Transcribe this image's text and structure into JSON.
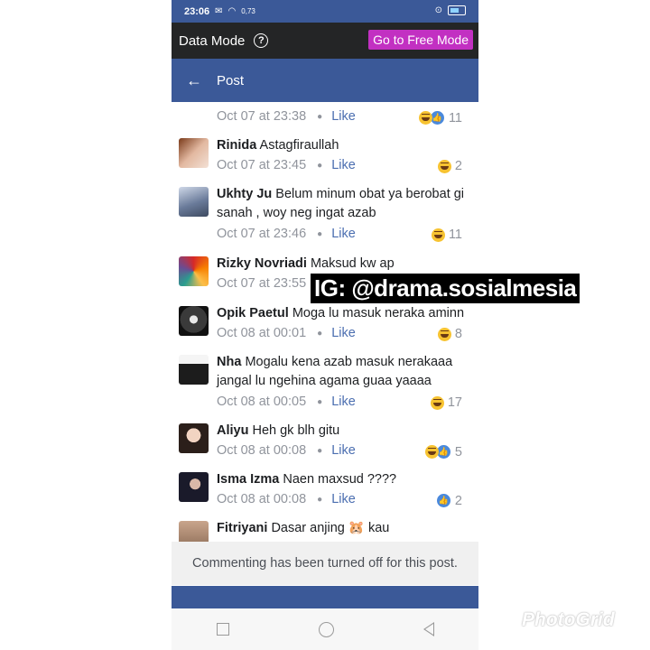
{
  "status_bar": {
    "time": "23:06",
    "net_speed": "0,73",
    "net_unit": "KB/S"
  },
  "data_mode": {
    "label": "Data Mode",
    "help_icon": "help-circle-icon",
    "free_mode_button": "Go to Free Mode"
  },
  "post_header": {
    "back_icon": "arrow-left-icon",
    "title": "Post"
  },
  "comments": [
    {
      "name": "",
      "text": "",
      "time": "Oct 07 at 23:38",
      "like_label": "Like",
      "reactions": [
        "haha",
        "like"
      ],
      "count": "11"
    },
    {
      "name": "Rinida",
      "text": "Astagfiraullah",
      "time": "Oct 07 at 23:45",
      "like_label": "Like",
      "reactions": [
        "haha"
      ],
      "count": "2"
    },
    {
      "name": "Ukhty Ju",
      "text": "Belum minum obat ya berobat gi sanah , woy neg ingat azab",
      "time": "Oct 07 at 23:46",
      "like_label": "Like",
      "reactions": [
        "haha"
      ],
      "count": "11"
    },
    {
      "name": "Rizky Novriadi",
      "text": "Maksud kw ap",
      "time": "Oct 07 at 23:55",
      "like_label": "",
      "reactions": [],
      "count": ""
    },
    {
      "name": "Opik Paetul",
      "text": "Moga lu masuk neraka aminn",
      "time": "Oct 08 at 00:01",
      "like_label": "Like",
      "reactions": [
        "haha"
      ],
      "count": "8"
    },
    {
      "name": "Nha",
      "text": "Mogalu kena azab masuk nerakaaa jangal lu ngehina agama guaa yaaaa",
      "time": "Oct 08 at 00:05",
      "like_label": "Like",
      "reactions": [
        "haha"
      ],
      "count": "17"
    },
    {
      "name": "Aliyu",
      "text": "Heh gk blh gitu",
      "time": "Oct 08 at 00:08",
      "like_label": "Like",
      "reactions": [
        "haha",
        "like"
      ],
      "count": "5"
    },
    {
      "name": "Isma Izma",
      "text": "Naen maxsud ????",
      "time": "Oct 08 at 00:08",
      "like_label": "Like",
      "reactions": [
        "like"
      ],
      "count": "2"
    },
    {
      "name": "Fitriyani",
      "text": "Dasar anjing 🐹 kau",
      "time": "",
      "like_label": "",
      "reactions": [],
      "count": ""
    }
  ],
  "comments_off": "Commenting has been turned off for this post.",
  "overlay": {
    "watermark": "IG: @drama.sosialmesia",
    "app_mark": "PhotoGrid"
  },
  "colors": {
    "fb_blue": "#3b5998",
    "free_mode": "#c230c2",
    "like_blue": "#4b6eb0"
  }
}
